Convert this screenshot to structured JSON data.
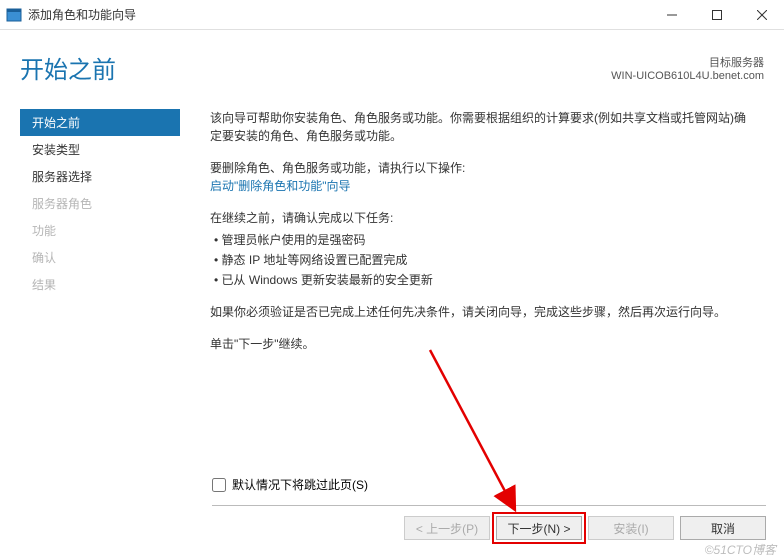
{
  "window": {
    "title": "添加角色和功能向导"
  },
  "header": {
    "heading": "开始之前",
    "server_label": "目标服务器",
    "server_name": "WIN-UICOB610L4U.benet.com"
  },
  "sidebar": {
    "items": [
      {
        "label": "开始之前",
        "state": "active"
      },
      {
        "label": "安装类型",
        "state": "normal"
      },
      {
        "label": "服务器选择",
        "state": "normal"
      },
      {
        "label": "服务器角色",
        "state": "disabled"
      },
      {
        "label": "功能",
        "state": "disabled"
      },
      {
        "label": "确认",
        "state": "disabled"
      },
      {
        "label": "结果",
        "state": "disabled"
      }
    ]
  },
  "content": {
    "intro": "该向导可帮助你安装角色、角色服务或功能。你需要根据组织的计算要求(例如共享文档或托管网站)确定要安装的角色、角色服务或功能。",
    "remove_prefix": "要删除角色、角色服务或功能，请执行以下操作:",
    "remove_link": "启动\"删除角色和功能\"向导",
    "before_continue": "在继续之前，请确认完成以下任务:",
    "bullets": [
      "管理员帐户使用的是强密码",
      "静态 IP 地址等网络设置已配置完成",
      "已从 Windows 更新安装最新的安全更新"
    ],
    "verify_text": "如果你必须验证是否已完成上述任何先决条件，请关闭向导，完成这些步骤，然后再次运行向导。",
    "click_next": "单击\"下一步\"继续。",
    "skip_checkbox": "默认情况下将跳过此页(S)"
  },
  "buttons": {
    "prev": "< 上一步(P)",
    "next": "下一步(N) >",
    "install": "安装(I)",
    "cancel": "取消"
  },
  "watermark": "©51CTO博客"
}
